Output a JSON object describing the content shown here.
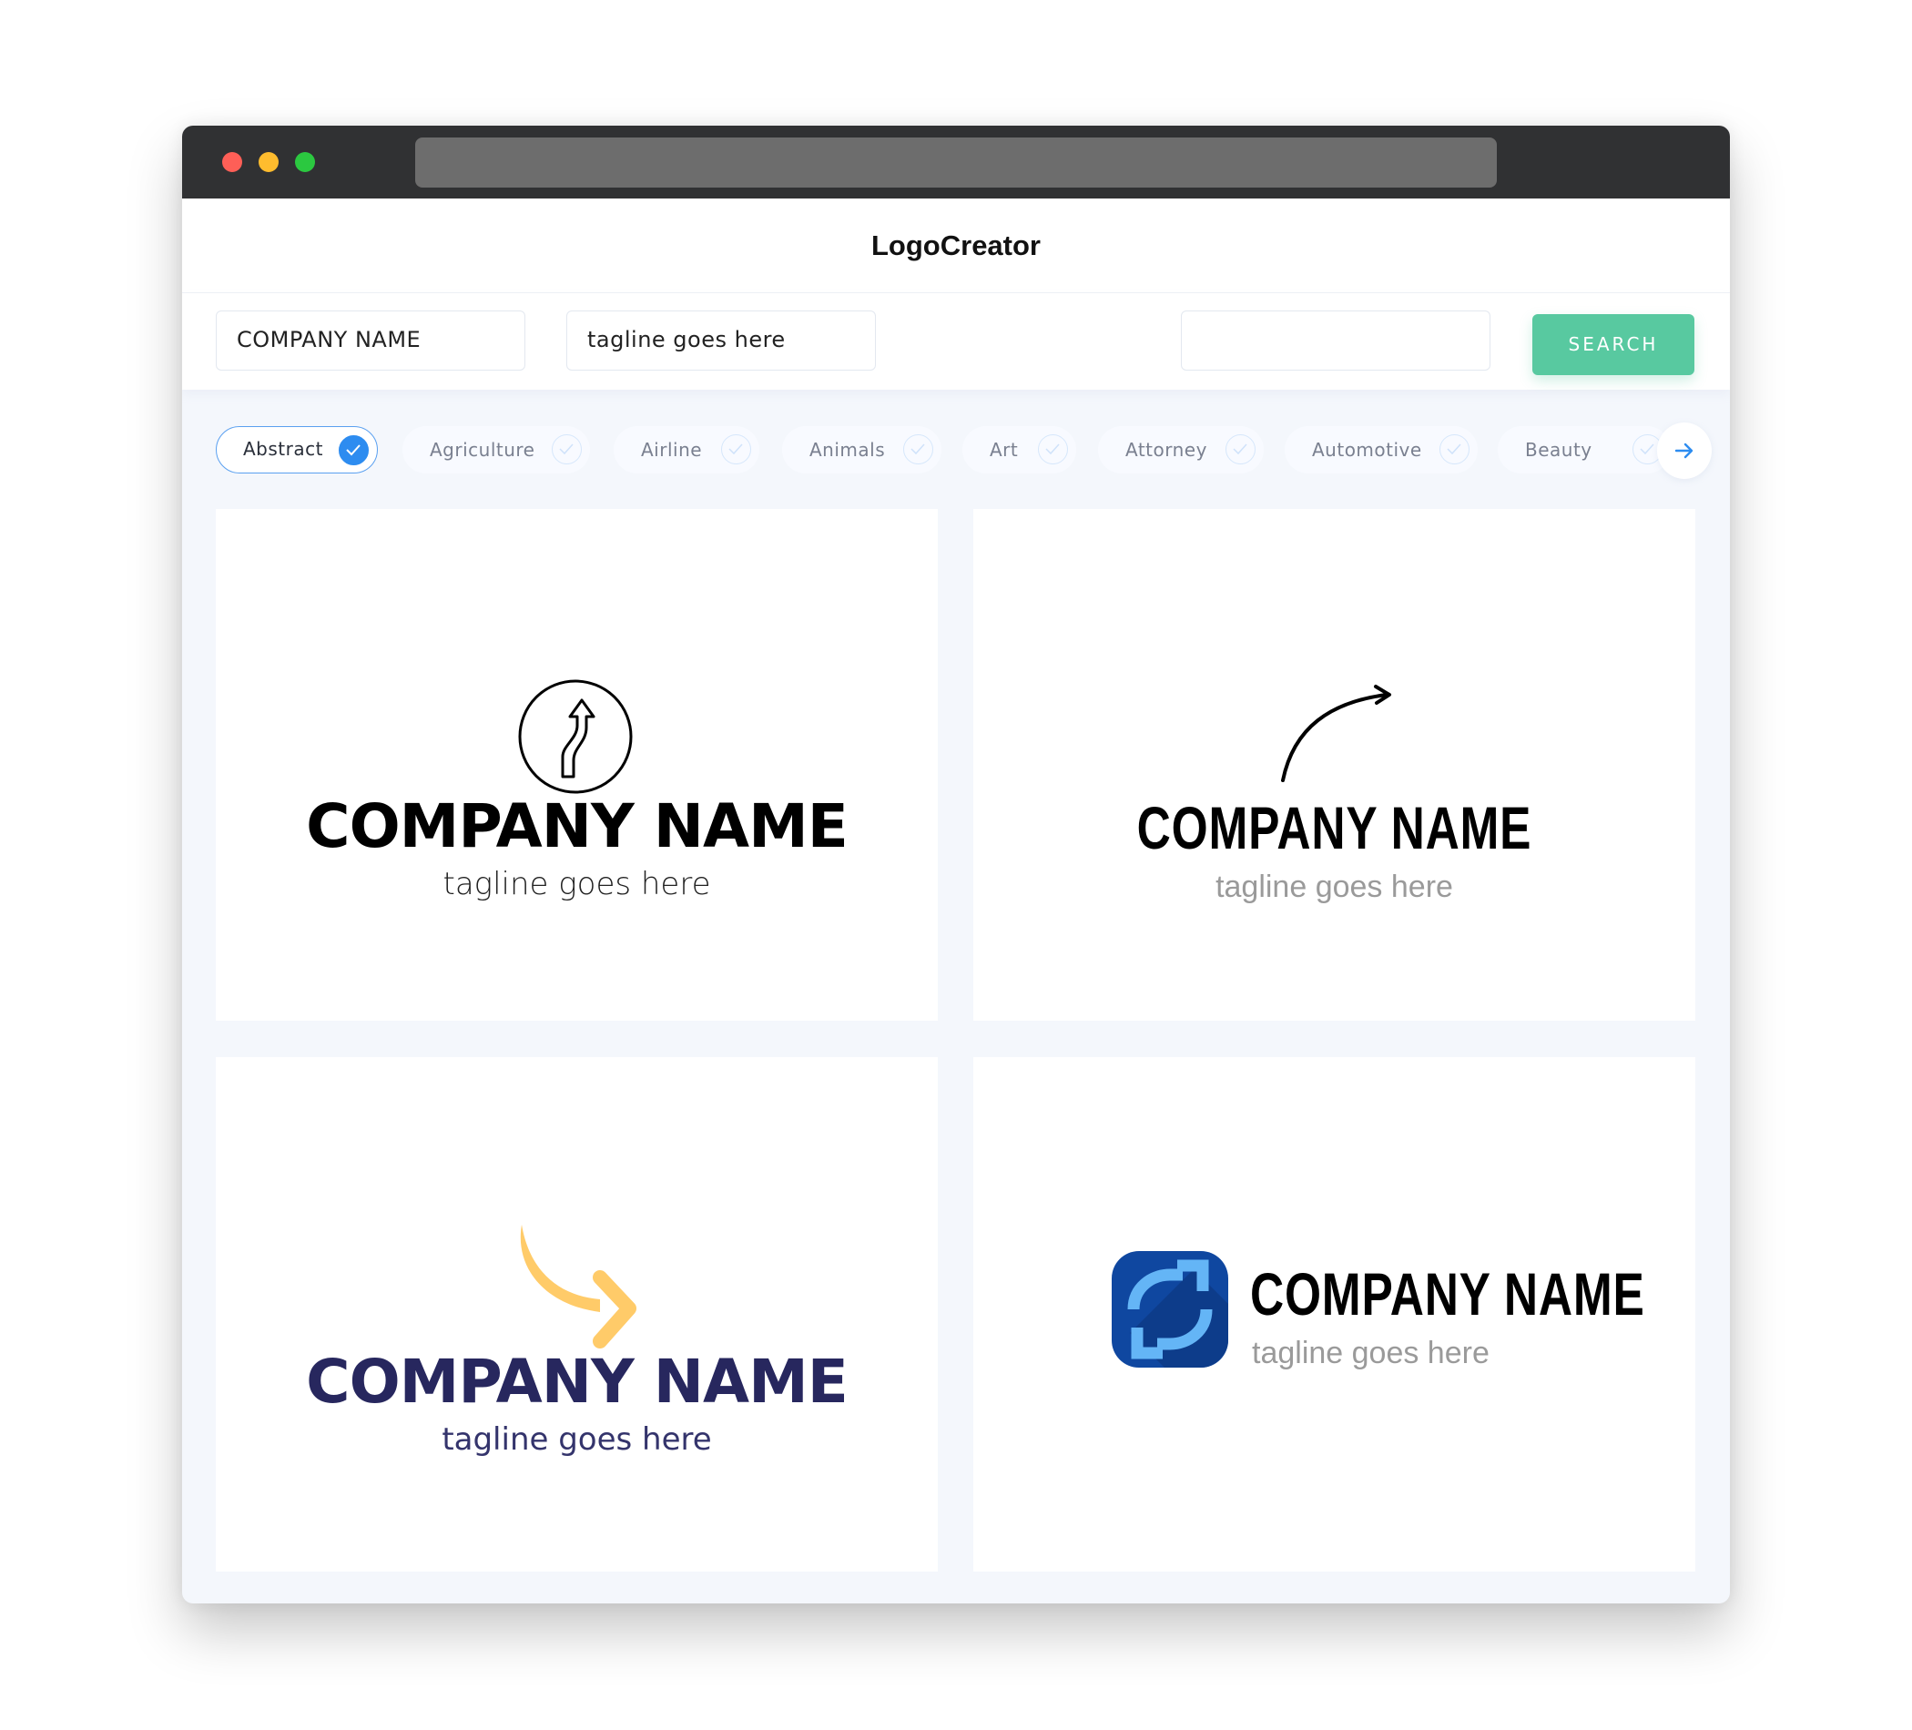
{
  "browser": {
    "window_controls": [
      "close",
      "minimize",
      "maximize"
    ],
    "url": ""
  },
  "header": {
    "brand": "LogoCreator"
  },
  "search": {
    "company_name_value": "COMPANY NAME",
    "tagline_value": "tagline goes here",
    "keyword_value": "",
    "search_label": "SEARCH",
    "accent_color": "#58c9a0"
  },
  "categories": {
    "items": [
      {
        "label": "Abstract",
        "selected": true
      },
      {
        "label": "Agriculture",
        "selected": false
      },
      {
        "label": "Airline",
        "selected": false
      },
      {
        "label": "Animals",
        "selected": false
      },
      {
        "label": "Art",
        "selected": false
      },
      {
        "label": "Attorney",
        "selected": false
      },
      {
        "label": "Automotive",
        "selected": false
      },
      {
        "label": "Beauty",
        "selected": false
      }
    ],
    "next_icon": "arrow-right-icon",
    "selected_color": "#2d8cf0"
  },
  "logos": [
    {
      "icon": "curved-arrow-in-circle-icon",
      "company_name": "COMPANY NAME",
      "tagline": "tagline goes here",
      "name_color": "#000000",
      "tagline_color": "#222222"
    },
    {
      "icon": "curved-line-arrow-icon",
      "company_name": "COMPANY NAME",
      "tagline": "tagline goes here",
      "name_color": "#000000",
      "tagline_color": "#9a9a9a"
    },
    {
      "icon": "yellow-curved-arrow-icon",
      "company_name": "COMPANY NAME",
      "tagline": "tagline goes here",
      "name_color": "#27275e",
      "tagline_color": "#34346c",
      "icon_color": "#ffcb69"
    },
    {
      "icon": "refresh-arrows-app-icon",
      "company_name": "COMPANY NAME",
      "tagline": "tagline goes here",
      "name_color": "#000000",
      "tagline_color": "#9a9a9a",
      "icon_bg": "#0f47a0",
      "icon_color": "#64b5f6"
    }
  ]
}
